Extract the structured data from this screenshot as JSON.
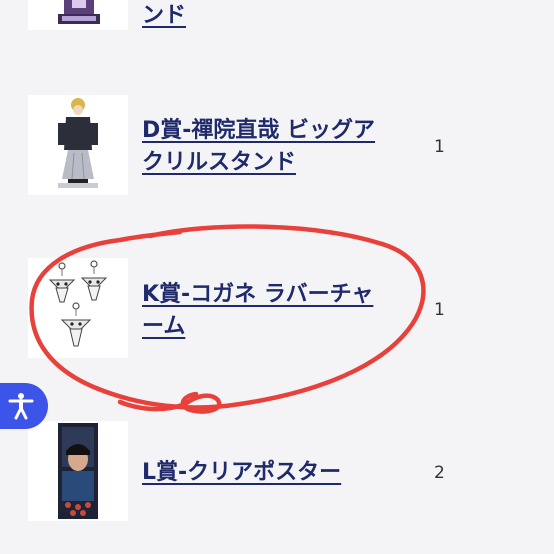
{
  "items": [
    {
      "line1": "ンド",
      "line2": "",
      "quantity": "",
      "image_icon": "acrylic-stand-figure-image"
    },
    {
      "line1": "D賞-禪院直哉 ビッグア",
      "line2": "クリルスタンド",
      "quantity": "1",
      "image_icon": "acrylic-stand-figure-image"
    },
    {
      "line1": "K賞-コガネ ラバーチャ",
      "line2": "ーム",
      "quantity": "1",
      "image_icon": "rubber-charm-image"
    },
    {
      "line1": "L賞-クリアポスター",
      "line2": "",
      "quantity": "2",
      "image_icon": "clear-poster-image"
    }
  ],
  "accessibility_button": {
    "icon": "accessibility-person-icon"
  },
  "annotation": {
    "color": "#e8413c"
  }
}
